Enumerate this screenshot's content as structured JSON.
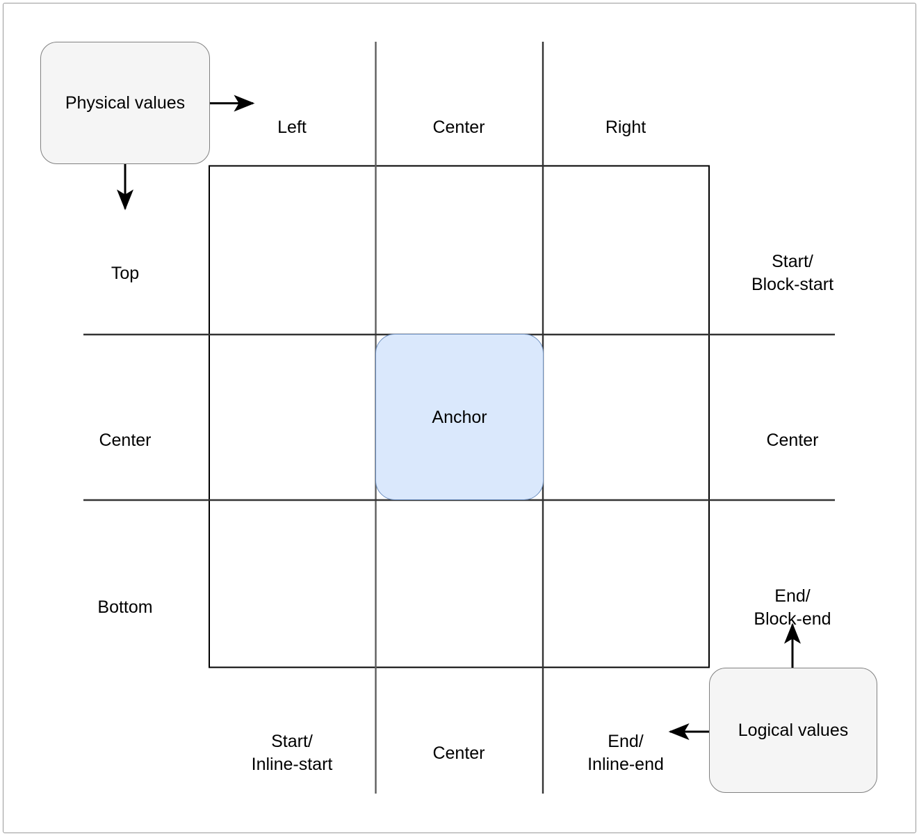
{
  "diagram": {
    "title": "CSS anchor positioning: physical vs logical position values",
    "nodes": {
      "physical_values": {
        "label": "Physical\nvalues",
        "fill": "#f5f5f5",
        "stroke": "#808080"
      },
      "logical_values": {
        "label": "Logical\nvalues",
        "fill": "#f5f5f5",
        "stroke": "#808080"
      },
      "anchor": {
        "label": "Anchor",
        "fill": "#dae8fc",
        "stroke": "#6c8ebf"
      }
    },
    "physical_labels": {
      "top_row": [
        {
          "key": "left",
          "text": "Left"
        },
        {
          "key": "center",
          "text": "Center"
        },
        {
          "key": "right",
          "text": "Right"
        }
      ],
      "left_column": [
        {
          "key": "top",
          "text": "Top"
        },
        {
          "key": "center",
          "text": "Center"
        },
        {
          "key": "bottom",
          "text": "Bottom"
        }
      ]
    },
    "logical_labels": {
      "right_column": [
        {
          "key": "block-start",
          "text": "Start/\nBlock-start"
        },
        {
          "key": "center",
          "text": "Center"
        },
        {
          "key": "block-end",
          "text": "End/\nBlock-end"
        }
      ],
      "bottom_row": [
        {
          "key": "inline-start",
          "text": "Start/\nInline-start"
        },
        {
          "key": "center",
          "text": "Center"
        },
        {
          "key": "inline-end",
          "text": "End/\nInline-end"
        }
      ]
    },
    "arrows": [
      {
        "key": "physical-to-left",
        "from": "physical_values",
        "to": "Left",
        "direction": "right"
      },
      {
        "key": "physical-to-top",
        "from": "physical_values",
        "to": "Top",
        "direction": "down"
      },
      {
        "key": "logical-to-block-end",
        "from": "logical_values",
        "to": "End/Block-end",
        "direction": "up"
      },
      {
        "key": "logical-to-inline-end",
        "from": "logical_values",
        "to": "End/Inline-end",
        "direction": "left"
      }
    ],
    "colors": {
      "grid_stroke": "#333333",
      "box_stroke": "#000000",
      "arrow": "#000000",
      "page_border": "#9a9a9a"
    }
  }
}
